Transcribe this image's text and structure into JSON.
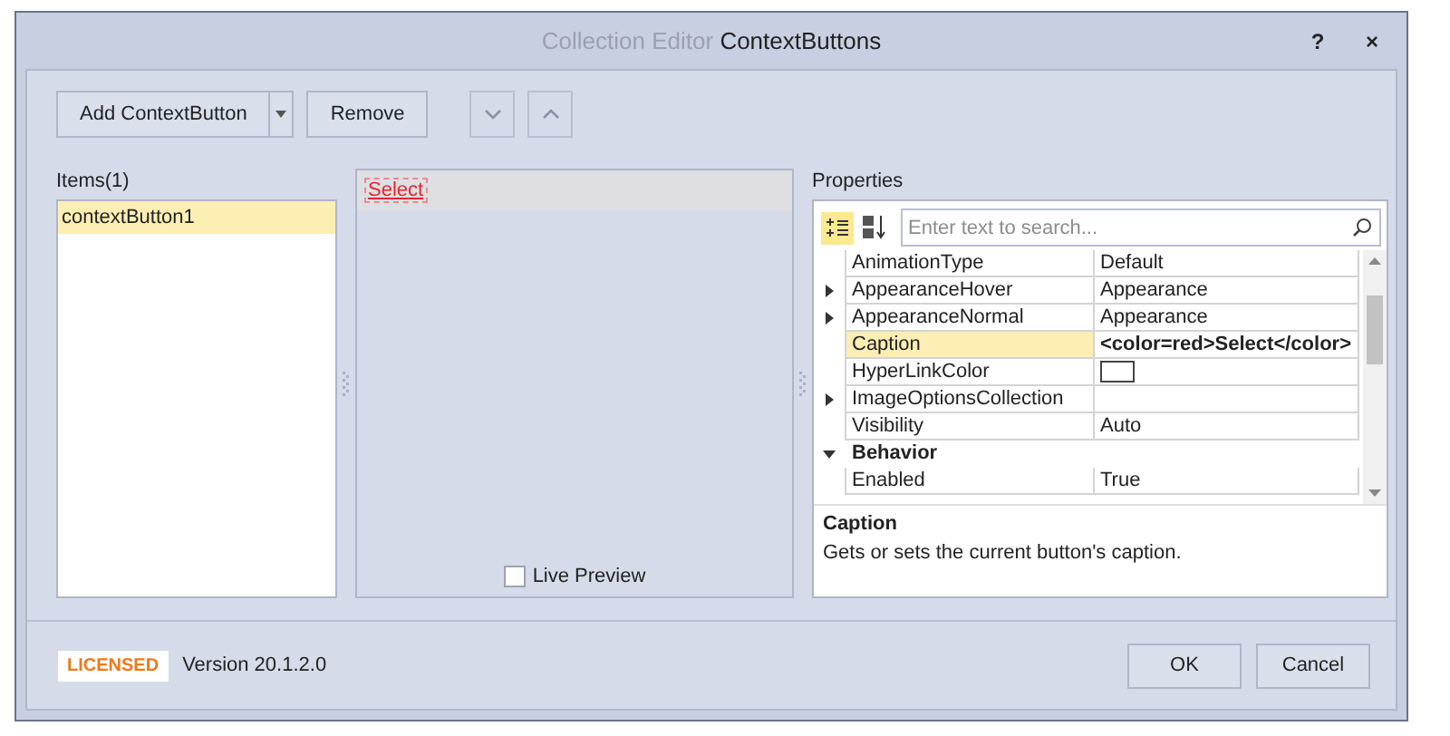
{
  "window": {
    "title_prefix": "Collection Editor",
    "title": "ContextButtons",
    "help": "?",
    "close": "×"
  },
  "toolbar": {
    "add_label": "Add ContextButton",
    "remove_label": "Remove"
  },
  "items": {
    "label": "Items(1)",
    "list": [
      {
        "label": "contextButton1",
        "selected": true
      }
    ]
  },
  "preview": {
    "button_caption": "Select",
    "live_preview": {
      "label": "Live Preview",
      "checked": false
    }
  },
  "properties": {
    "label": "Properties",
    "search_placeholder": "Enter text to search...",
    "sort_modes": [
      {
        "kind": "categorized",
        "selected": true
      },
      {
        "kind": "alphabetical",
        "selected": false
      }
    ],
    "rows": [
      {
        "kind": "property",
        "name": "AnimationType",
        "value": "Default",
        "selected": false,
        "modified": false
      },
      {
        "kind": "expandable",
        "name": "AppearanceHover",
        "value": "Appearance",
        "selected": false,
        "modified": false
      },
      {
        "kind": "expandable",
        "name": "AppearanceNormal",
        "value": "Appearance",
        "selected": false,
        "modified": false
      },
      {
        "kind": "property",
        "name": "Caption",
        "value": "<color=red>Select</color>",
        "selected": true,
        "modified": true
      },
      {
        "kind": "swatch",
        "name": "HyperLinkColor",
        "selected": false
      },
      {
        "kind": "expandable",
        "name": "ImageOptionsCollection",
        "selected": false
      },
      {
        "kind": "property",
        "name": "Visibility",
        "value": "Auto",
        "selected": false,
        "modified": false
      },
      {
        "kind": "category",
        "name": "Behavior",
        "expanded": true
      },
      {
        "kind": "property",
        "name": "Enabled",
        "value": "True",
        "selected": false,
        "modified": false
      }
    ],
    "description": {
      "title": "Caption",
      "text": "Gets or sets the current button's caption."
    }
  },
  "footer": {
    "badge": "LICENSED",
    "version": "Version 20.1.2.0",
    "buttons": [
      "OK",
      "Cancel"
    ]
  }
}
